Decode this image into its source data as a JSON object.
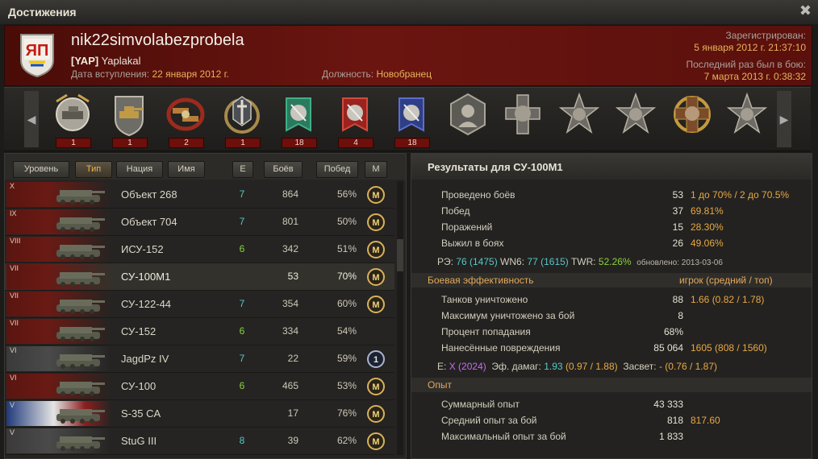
{
  "window": {
    "title": "Достижения"
  },
  "profile": {
    "name": "nik22simvolabezprobela",
    "clan_tag": "[YAP]",
    "clan_name": "Yaplakal",
    "joined_label": "Дата вступления:",
    "joined_value": "22 января 2012 г.",
    "position_label": "Должность:",
    "position_value": "Новобранец",
    "registered_label": "Зарегистрирован:",
    "registered_value": "5 января 2012 г. 21:37:10",
    "last_battle_label": "Последний раз был в бою:",
    "last_battle_value": "7 марта 2013 г. 0:38:32",
    "emblem_text": "ЯП"
  },
  "medals": [
    {
      "icon": "tank-expert-medal-icon",
      "count": "1"
    },
    {
      "icon": "gun-tank-medal-icon",
      "count": "1"
    },
    {
      "icon": "tank-wreath-medal-icon",
      "count": "2"
    },
    {
      "icon": "sword-wreath-medal-icon",
      "count": "1"
    },
    {
      "icon": "green-ribbon-medal-icon",
      "count": "18"
    },
    {
      "icon": "red-ribbon-medal-icon",
      "count": "4"
    },
    {
      "icon": "blue-ribbon-medal-icon",
      "count": "18"
    },
    {
      "icon": "portrait-hexagon-medal-icon",
      "count": ""
    },
    {
      "icon": "portrait-cross-medal-icon",
      "count": ""
    },
    {
      "icon": "portrait-star-medal-icon",
      "count": ""
    },
    {
      "icon": "portrait-star-medal-icon",
      "count": ""
    },
    {
      "icon": "portrait-gold-wreath-medal-icon",
      "count": ""
    },
    {
      "icon": "portrait-star-medal-icon",
      "count": ""
    }
  ],
  "sort_buttons": {
    "level": "Уровень",
    "type": "Тип",
    "nation": "Нация",
    "name": "Имя",
    "e": "E",
    "battles": "Боёв",
    "wins": "Побед",
    "mastery": "M"
  },
  "vehicles": [
    {
      "tier": "X",
      "name": "Объект 268",
      "e": "7",
      "battles": "864",
      "win": "56%",
      "mastery": "M",
      "nation": "ussr"
    },
    {
      "tier": "IX",
      "name": "Объект 704",
      "e": "7",
      "battles": "801",
      "win": "50%",
      "mastery": "M",
      "nation": "ussr"
    },
    {
      "tier": "VIII",
      "name": "ИСУ-152",
      "e": "6",
      "battles": "342",
      "win": "51%",
      "mastery": "M",
      "nation": "ussr"
    },
    {
      "tier": "VII",
      "name": "СУ-100М1",
      "e": "",
      "battles": "53",
      "win": "70%",
      "mastery": "M",
      "nation": "ussr"
    },
    {
      "tier": "VII",
      "name": "СУ-122-44",
      "e": "7",
      "battles": "354",
      "win": "60%",
      "mastery": "M",
      "nation": "ussr"
    },
    {
      "tier": "VII",
      "name": "СУ-152",
      "e": "6",
      "battles": "334",
      "win": "54%",
      "mastery": "",
      "nation": "ussr"
    },
    {
      "tier": "VI",
      "name": "JagdPz IV",
      "e": "7",
      "battles": "22",
      "win": "59%",
      "mastery": "1",
      "nation": "germany"
    },
    {
      "tier": "VI",
      "name": "СУ-100",
      "e": "6",
      "battles": "465",
      "win": "53%",
      "mastery": "M",
      "nation": "ussr"
    },
    {
      "tier": "V",
      "name": "S-35 CA",
      "e": "",
      "battles": "17",
      "win": "76%",
      "mastery": "M",
      "nation": "france"
    },
    {
      "tier": "V",
      "name": "StuG III",
      "e": "8",
      "battles": "39",
      "win": "62%",
      "mastery": "M",
      "nation": "germany"
    }
  ],
  "results": {
    "title": "Результаты для СУ-100М1",
    "rows": [
      {
        "label": "Проведено боёв",
        "value": "53",
        "extra": "1 до 70% / 2 до 70.5%"
      },
      {
        "label": "Побед",
        "value": "37",
        "extra": "69.81%"
      },
      {
        "label": "Поражений",
        "value": "15",
        "extra": "28.30%"
      },
      {
        "label": "Выжил в боях",
        "value": "26",
        "extra": "49.06%"
      }
    ],
    "rating": {
      "re_label": "РЭ:",
      "re_value": "76",
      "re_paren": "(1475)",
      "wn6_label": "WN6:",
      "wn6_value": "77",
      "wn6_paren": "(1615)",
      "twr_label": "TWR:",
      "twr_value": "52.26%",
      "updated": "обновлено: 2013-03-06"
    },
    "combat_section": "Боевая эффективность",
    "combat_section_right": "игрок (средний / топ)",
    "combat_rows": [
      {
        "label": "Танков уничтожено",
        "value": "88",
        "extra": "1.66 (0.82 / 1.78)"
      },
      {
        "label": "Максимум уничтожено за бой",
        "value": "8",
        "extra": ""
      },
      {
        "label": "Процент попадания",
        "value": "68%",
        "extra": ""
      },
      {
        "label": "Нанесённые повреждения",
        "value": "85 064",
        "extra": "1605 (808 / 1560)"
      }
    ],
    "eff": {
      "e_label": "E:",
      "e_value": "X",
      "e_paren": "(2024)",
      "dmg_label": "Эф. дамаг:",
      "dmg_value": "1.93",
      "dmg_paren": "(0.97 / 1.88)",
      "spot_label": "Засвет:",
      "spot_value": "- (0.76 / 1.87)"
    },
    "exp_section": "Опыт",
    "exp_rows": [
      {
        "label": "Суммарный опыт",
        "value": "43 333",
        "extra": ""
      },
      {
        "label": "Средний опыт за бой",
        "value": "818",
        "extra": "817.60"
      },
      {
        "label": "Максимальный опыт за бой",
        "value": "1 833",
        "extra": ""
      }
    ]
  }
}
